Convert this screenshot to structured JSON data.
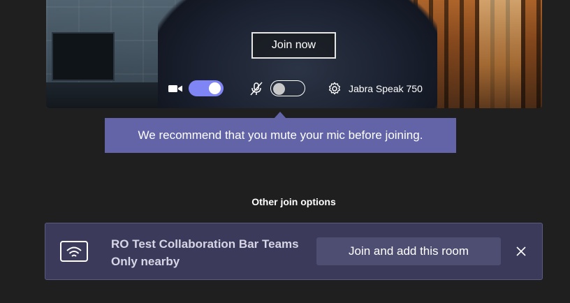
{
  "preview": {
    "join_now_label": "Join now",
    "camera_toggle_on": true,
    "mic_toggle_on": false,
    "device_name": "Jabra Speak 750"
  },
  "tooltip": {
    "text": "We recommend that you mute your mic before joining."
  },
  "other_options": {
    "title": "Other join options",
    "room": {
      "name": "RO Test Collaboration Bar Teams",
      "subtitle": "Only nearby",
      "action_label": "Join and add this room"
    }
  },
  "icons": [
    "video-camera-icon",
    "mic-off-icon",
    "gear-icon",
    "wifi-room-icon",
    "close-icon"
  ],
  "colors": {
    "accent": "#6264a7",
    "toggle_on": "#7f85f5",
    "background": "#201f1f",
    "room_card": "#3b3a5a"
  }
}
